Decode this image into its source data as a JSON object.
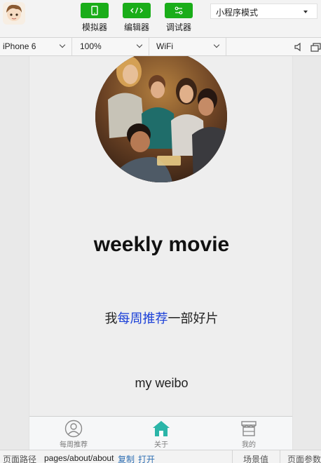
{
  "toolbar": {
    "buttons": [
      {
        "label": "模拟器",
        "icon": "phone-icon"
      },
      {
        "label": "编辑器",
        "icon": "code-icon"
      },
      {
        "label": "调试器",
        "icon": "toggles-icon"
      }
    ],
    "mode_select": "小程序模式",
    "accent": "#1aad19"
  },
  "device_bar": {
    "device": "iPhone 6",
    "zoom": "100%",
    "network": "WiFi"
  },
  "page": {
    "title": "weekly movie",
    "line_prefix": "我",
    "line_highlight": "每周推荐",
    "line_suffix": "一部好片",
    "weibo": "my weibo",
    "highlight_color": "#1a3fd8"
  },
  "tabbar": {
    "tabs": [
      {
        "label": "每周推荐",
        "icon": "person-circle-icon"
      },
      {
        "label": "关于",
        "icon": "home-icon",
        "active": true
      },
      {
        "label": "我的",
        "icon": "store-icon"
      }
    ],
    "active_color": "#2bb5a8"
  },
  "statusbar": {
    "path_label": "页面路径",
    "path": "pages/about/about",
    "copy": "复制",
    "open": "打开",
    "scene": "场景值",
    "params": "页面参数"
  }
}
